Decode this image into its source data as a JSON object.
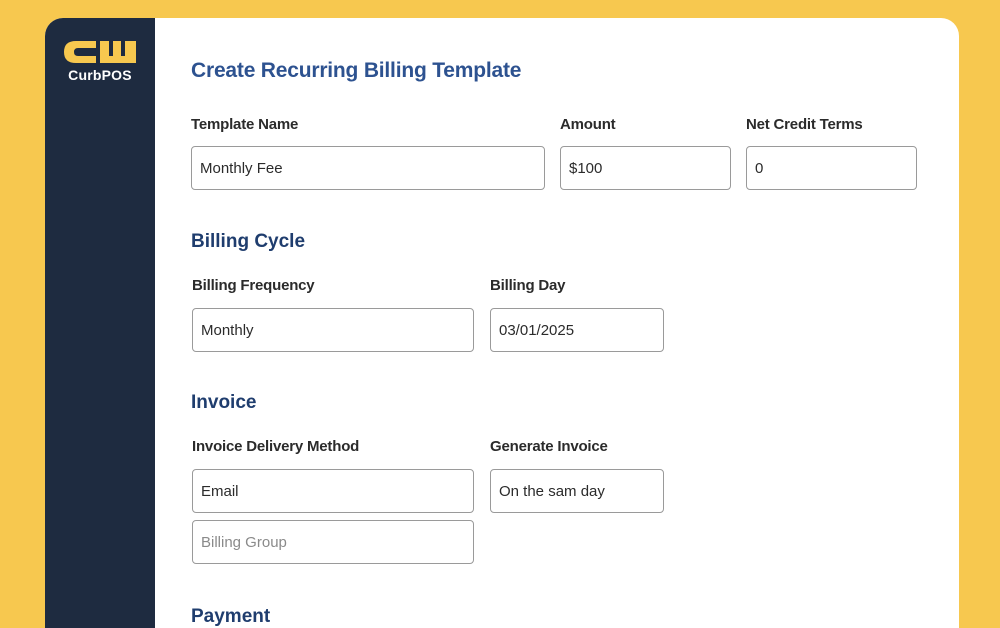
{
  "app": {
    "brand_name": "CurbPOS",
    "logo_icon": "curbpos-logo-icon",
    "colors": {
      "background": "#f7c84f",
      "sidebar": "#1e2b40",
      "title": "#2d5290",
      "section": "#1f3d6e"
    }
  },
  "page": {
    "title": "Create Recurring Billing Template"
  },
  "template": {
    "name_label": "Template Name",
    "name_value": "Monthly Fee",
    "amount_label": "Amount",
    "amount_value": "$100",
    "net_terms_label": "Net Credit Terms",
    "net_terms_value": "0"
  },
  "billing_cycle": {
    "title": "Billing Cycle",
    "frequency_label": "Billing Frequency",
    "frequency_value": "Monthly",
    "day_label": "Billing Day",
    "day_value": "03/01/2025"
  },
  "invoice": {
    "title": "Invoice",
    "delivery_label": "Invoice Delivery Method",
    "delivery_value": "Email",
    "billing_group_placeholder": "Billing Group",
    "generate_label": "Generate Invoice",
    "generate_value": "On the sam day"
  },
  "payment": {
    "title": "Payment"
  }
}
